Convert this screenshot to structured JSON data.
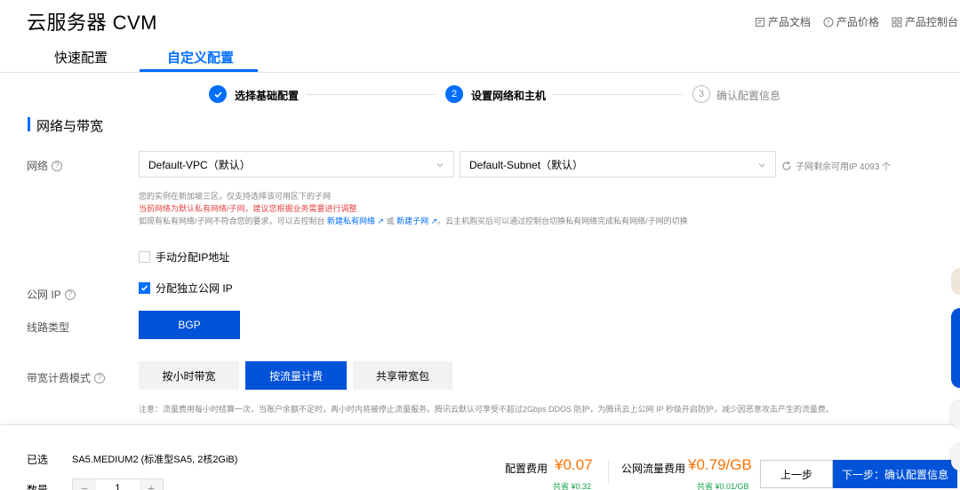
{
  "header": {
    "title": "云服务器 CVM",
    "links": [
      {
        "label": "产品文档",
        "icon": "doc-icon"
      },
      {
        "label": "产品价格",
        "icon": "help-circle-icon"
      },
      {
        "label": "产品控制台",
        "icon": "grid-icon"
      }
    ]
  },
  "tabs": [
    {
      "label": "快速配置",
      "active": false
    },
    {
      "label": "自定义配置",
      "active": true
    }
  ],
  "steps": [
    {
      "number": "✓",
      "label": "选择基础配置",
      "state": "done"
    },
    {
      "number": "2",
      "label": "设置网络和主机",
      "state": "active"
    },
    {
      "number": "3",
      "label": "确认配置信息",
      "state": "future"
    }
  ],
  "section": {
    "title": "网络与带宽"
  },
  "network": {
    "label": "网络",
    "help": "?",
    "vpc": "Default-VPC（默认）",
    "subnet": "Default-Subnet（默认）",
    "available": "子网剩余可用IP 4093 个",
    "note1": "您的实例在新加坡三区，仅支持选择该可用区下的子网",
    "note2": "当前网络为默认私有网络/子网，建议您根据业务需要进行调整",
    "note3_prefix": "如现有私有网络/子网不符合您的要求，可以去控制台 ",
    "note3_link1": "新建私有网络",
    "note3_or": " 或 ",
    "note3_link2": "新建子网",
    "note3_suffix": "。云主机购买后可以通过控制台切换私有网络完成私有网络/子网的切换"
  },
  "manual_ip": {
    "label": "手动分配IP地址",
    "checked": false
  },
  "public_ip": {
    "label": "公网 IP",
    "help": "?",
    "option": "分配独立公网 IP",
    "checked": true
  },
  "line_type": {
    "label": "线路类型",
    "value": "BGP"
  },
  "billing": {
    "label": "带宽计费模式",
    "help": "?",
    "options": [
      "按小时带宽",
      "按流量计费",
      "共享带宽包"
    ],
    "selected": "按流量计费",
    "note": "注意：流量费用每小时结算一次，当账户余额不足时，两小时内将被停止流量服务。腾讯云默认可享受不超过2Gbps DDOS 防护，为腾讯云上公网 IP 秒级开启防护，减少因恶意攻击产生的流量费。"
  },
  "footer": {
    "selected_label": "已选",
    "selected_value": "SA5.MEDIUM2 (标准型SA5, 2核2GiB)",
    "qty_label": "数量",
    "qty_value": "1",
    "minus": "−",
    "plus": "+",
    "config_fee_label": "配置费用",
    "config_fee": "¥0.07",
    "config_save": "共省 ¥0.32",
    "traffic_fee_label": "公网流量费用",
    "traffic_fee": "¥0.79/GB",
    "traffic_save": "共省 ¥0.01/GB",
    "prev": "上一步",
    "next": "下一步：确认配置信息"
  },
  "colors": {
    "primary": "#006eff",
    "button": "#0052d9",
    "price": "#ff7200",
    "save": "#19a04b",
    "warning": "#e54545"
  }
}
